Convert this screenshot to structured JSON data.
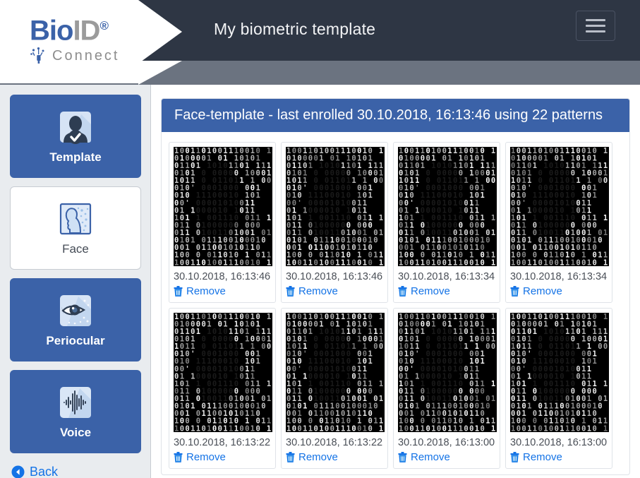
{
  "brand": {
    "name_part1": "Bio",
    "name_part2": "ID",
    "registered_mark": "®",
    "tagline": "Connect",
    "logo_icon": "bioid-connect-logo",
    "primary_color": "#3b62a8",
    "gray_color": "#9b9b9b"
  },
  "header": {
    "title": "My biometric template",
    "menu_button_icon": "hamburger-menu-icon",
    "background_color": "#2e3644",
    "subbar_color": "#6b7380"
  },
  "sidebar": {
    "items": [
      {
        "label": "Template",
        "icon": "template-portrait-check-icon",
        "active": false
      },
      {
        "label": "Face",
        "icon": "face-profile-icon",
        "active": true
      },
      {
        "label": "Periocular",
        "icon": "eye-periocular-icon",
        "active": false
      },
      {
        "label": "Voice",
        "icon": "voice-waveform-icon",
        "active": false
      }
    ],
    "back": {
      "label": "Back",
      "icon": "back-arrow-circle-icon"
    }
  },
  "main": {
    "panel_title": "Face-template - last enrolled 30.10.2018, 16:13:46 using 22 patterns",
    "panel_header_color": "#3b62a8",
    "remove_label": "Remove",
    "remove_icon": "trash-can-icon",
    "thumbnails": [
      {
        "date": "30.10.2018, 16:13:46",
        "image": "binary-face-pattern"
      },
      {
        "date": "30.10.2018, 16:13:46",
        "image": "binary-face-pattern"
      },
      {
        "date": "30.10.2018, 16:13:34",
        "image": "binary-face-pattern"
      },
      {
        "date": "30.10.2018, 16:13:34",
        "image": "binary-face-pattern"
      },
      {
        "date": "30.10.2018, 16:13:22",
        "image": "binary-face-pattern"
      },
      {
        "date": "30.10.2018, 16:13:22",
        "image": "binary-face-pattern"
      },
      {
        "date": "30.10.2018, 16:13:00",
        "image": "binary-face-pattern"
      },
      {
        "date": "30.10.2018, 16:13:00",
        "image": "binary-face-pattern"
      }
    ],
    "binary_rows": [
      "1001101001110010 1",
      "0100001 01 10101",
      "01101 10101101 1110",
      "0101 0 00000 10001",
      "1011 0 011011 1 000",
      "010' 0001000 001",
      "010 11100010 101",
      "00' 00001010011",
      "01 1000010 1011",
      "101 1 001110 011 10",
      "011 01000000 000",
      "011 01001101001 01",
      "0101 011100100010",
      "001 011001010110",
      "100 0 011010 1 011"
    ]
  }
}
